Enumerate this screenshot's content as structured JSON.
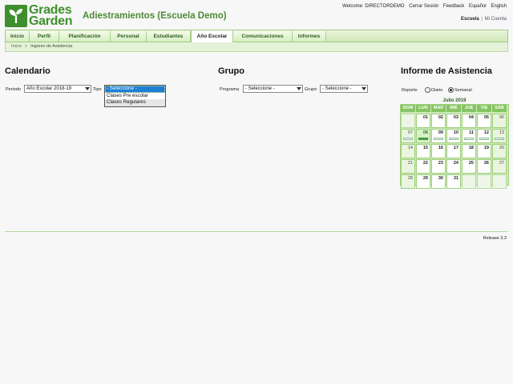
{
  "brand": {
    "logo_line1": "Grades",
    "logo_line2": "Garden",
    "school_title": "Adiestramientos (Escuela Demo)"
  },
  "top_links": {
    "welcome": "Welcome: DIRECTORDEMO",
    "logout": "Cerrar Sesión",
    "feedback": "Feedback",
    "lang_es": "Español",
    "lang_en": "English"
  },
  "context": {
    "school": "Escuela",
    "separator": "|",
    "account": "Mi Cuenta"
  },
  "nav": {
    "tabs": [
      {
        "label": "Inicio"
      },
      {
        "label": "Perfil"
      },
      {
        "label": "Planificación"
      },
      {
        "label": "Personal"
      },
      {
        "label": "Estudiantes"
      },
      {
        "label": "Año Escolar",
        "active": true
      },
      {
        "label": "Comunicaciones"
      },
      {
        "label": "Informes"
      }
    ]
  },
  "breadcrumb": {
    "home": "Inicio",
    "separator": ">",
    "current": "Ingreso de Asistencia"
  },
  "calendario": {
    "title": "Calendario",
    "periodo_label": "Periodo",
    "periodo_value": "Año Escolar 2018-19",
    "tipo_label": "Tipo",
    "tipo_options": [
      "- Seleccione -",
      "Clases Pre escolar",
      "Clases Regulares"
    ],
    "tipo_selected": "- Seleccione -"
  },
  "grupo": {
    "title": "Grupo",
    "programa_label": "Programa",
    "programa_value": "- Seleccione -",
    "grupo_label": "Grupo",
    "grupo_value": "- Seleccione -"
  },
  "informe": {
    "title": "Informe de Asistencia",
    "reporte_label": "Reporte",
    "diario_label": "Diario",
    "semanal_label": "Semanal",
    "selected": "Semanal",
    "month": "Julio 2019",
    "weekdays": [
      "DOM",
      "LUN",
      "MAR",
      "MIÉ",
      "JUE",
      "VIE",
      "SÁB"
    ],
    "weeks": [
      [
        "",
        "01",
        "02",
        "03",
        "04",
        "05",
        "06"
      ],
      [
        "07",
        "08",
        "09",
        "10",
        "11",
        "12",
        "13"
      ],
      [
        "14",
        "15",
        "16",
        "17",
        "18",
        "19",
        "20"
      ],
      [
        "21",
        "22",
        "23",
        "24",
        "25",
        "26",
        "27"
      ],
      [
        "28",
        "29",
        "30",
        "31",
        "",
        "",
        ""
      ]
    ],
    "today": "08"
  },
  "footer": {
    "release": "Release 3.3"
  },
  "colors": {
    "brand_green": "#3f8f2e",
    "nav_border": "#9fcb80",
    "calendar_header": "#86c463",
    "selection_blue": "#1e7fd6"
  }
}
